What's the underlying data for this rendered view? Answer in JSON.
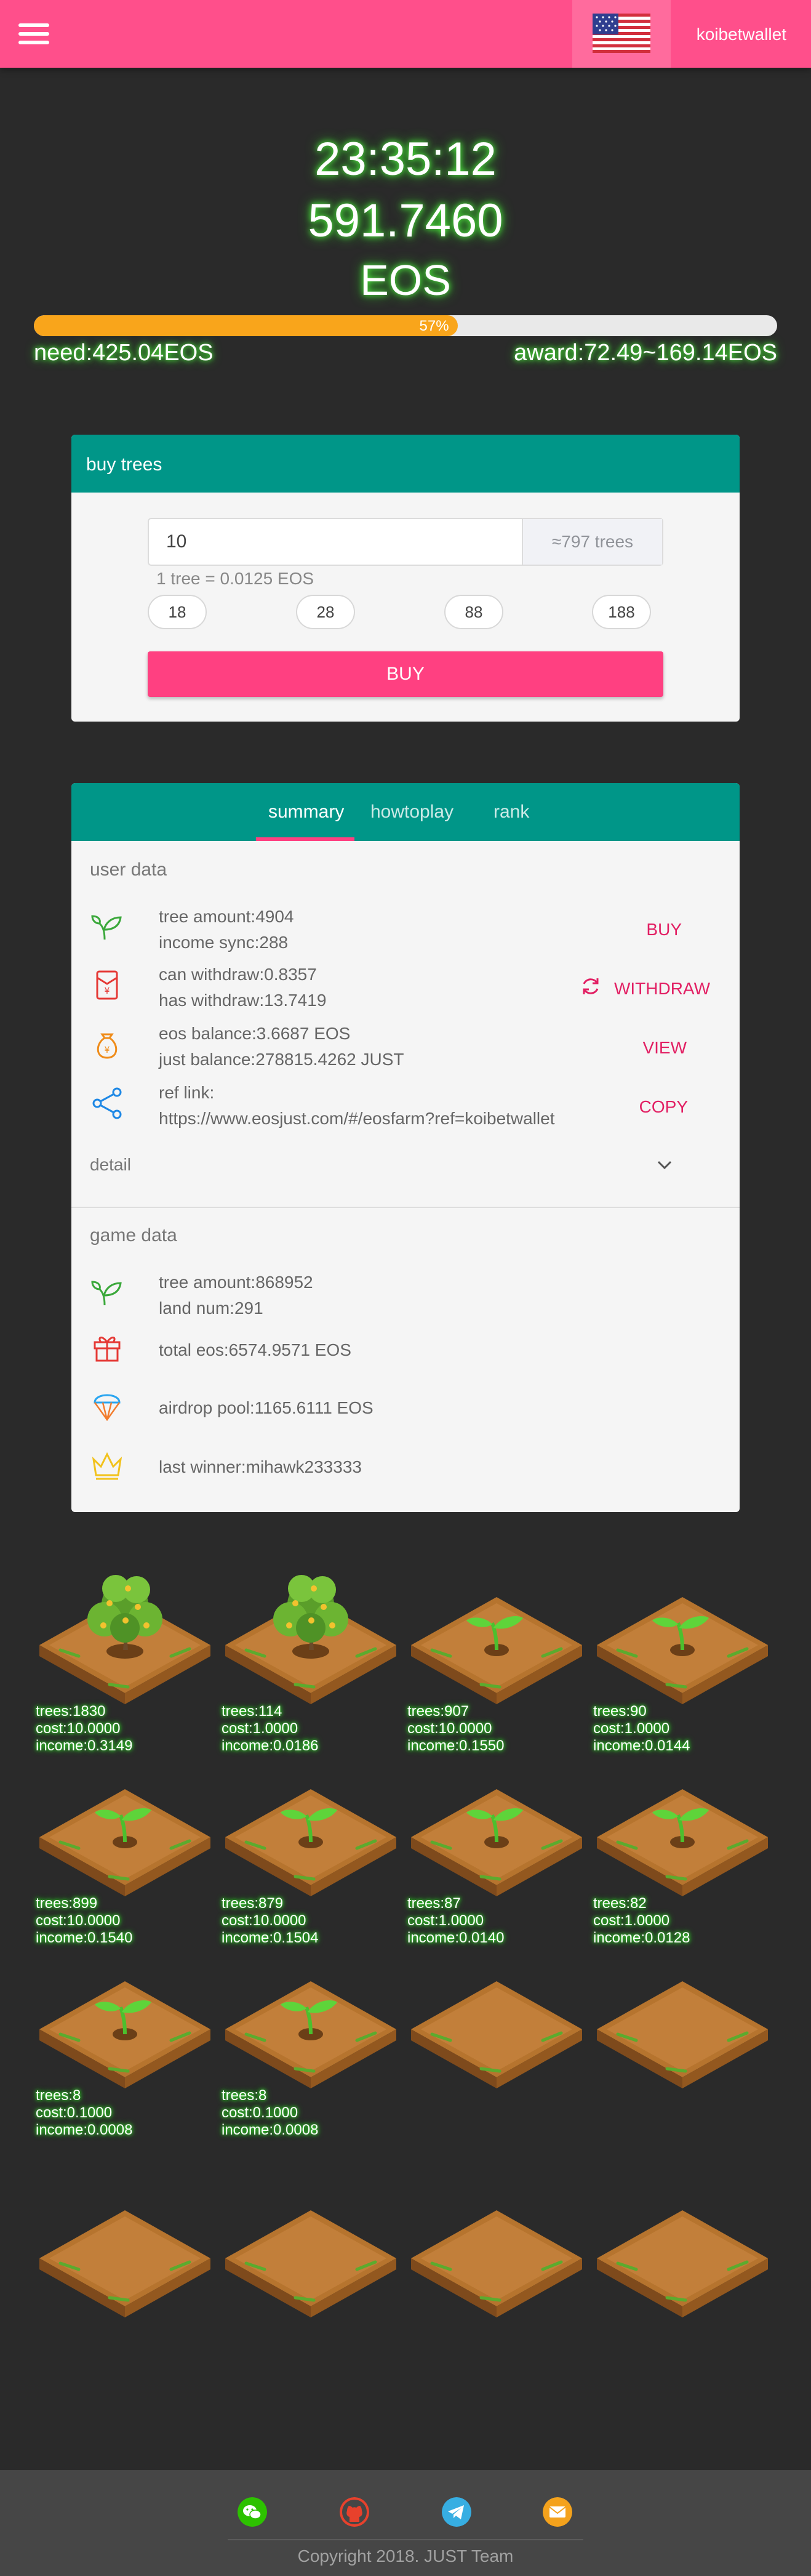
{
  "header": {
    "username": "koibetwallet",
    "flag_icon": "us-flag-icon"
  },
  "hero": {
    "time": "23:35:12",
    "pool": "591.7460",
    "unit": "EOS",
    "progress_label": "57%",
    "progress_fraction": 0.57,
    "need": "need:425.04EOS",
    "award": "award:72.49~169.14EOS"
  },
  "buy": {
    "title": "buy trees",
    "input_value": "10",
    "estimate": "≈797 trees",
    "rate": "1 tree = 0.0125 EOS",
    "chips": [
      "18",
      "28",
      "88",
      "188"
    ],
    "button": "BUY"
  },
  "tabs": [
    "summary",
    "howtoplay",
    "rank"
  ],
  "user_data": {
    "label": "user data",
    "rows": [
      {
        "line1": "tree amount:4904",
        "line2": "income sync:288",
        "action": "BUY"
      },
      {
        "line1": "can withdraw:0.8357",
        "line2": "has withdraw:13.7419",
        "action": "WITHDRAW"
      },
      {
        "line1": "eos balance:3.6687 EOS",
        "line2": "just balance:278815.4262 JUST",
        "action": "VIEW"
      },
      {
        "line1": "ref link:",
        "line2": "https://www.eosjust.com/#/eosfarm?ref=koibetwallet",
        "action": "COPY"
      }
    ],
    "detail": "detail"
  },
  "game_data": {
    "label": "game data",
    "rows": [
      {
        "line1": "tree amount:868952",
        "line2": "land num:291"
      },
      {
        "line1": "total eos:6574.9571 EOS"
      },
      {
        "line1": "airdrop pool:1165.6111 EOS"
      },
      {
        "line1": "last winner:mihawk233333"
      }
    ]
  },
  "plots": [
    {
      "kind": "tree",
      "trees": "trees:1830",
      "cost": "cost:10.0000",
      "income": "income:0.3149"
    },
    {
      "kind": "tree",
      "trees": "trees:114",
      "cost": "cost:1.0000",
      "income": "income:0.0186"
    },
    {
      "kind": "sprout",
      "trees": "trees:907",
      "cost": "cost:10.0000",
      "income": "income:0.1550"
    },
    {
      "kind": "sprout",
      "trees": "trees:90",
      "cost": "cost:1.0000",
      "income": "income:0.0144"
    },
    {
      "kind": "sprout",
      "trees": "trees:899",
      "cost": "cost:10.0000",
      "income": "income:0.1540"
    },
    {
      "kind": "sprout",
      "trees": "trees:879",
      "cost": "cost:10.0000",
      "income": "income:0.1504"
    },
    {
      "kind": "sprout",
      "trees": "trees:87",
      "cost": "cost:1.0000",
      "income": "income:0.0140"
    },
    {
      "kind": "sprout",
      "trees": "trees:82",
      "cost": "cost:1.0000",
      "income": "income:0.0128"
    },
    {
      "kind": "sprout",
      "trees": "trees:8",
      "cost": "cost:0.1000",
      "income": "income:0.0008"
    },
    {
      "kind": "sprout",
      "trees": "trees:8",
      "cost": "cost:0.1000",
      "income": "income:0.0008"
    },
    {
      "kind": "empty"
    },
    {
      "kind": "empty"
    },
    {
      "kind": "empty"
    },
    {
      "kind": "empty"
    },
    {
      "kind": "empty"
    },
    {
      "kind": "empty"
    }
  ],
  "footer": {
    "icons": [
      "wechat-icon",
      "github-icon",
      "telegram-icon",
      "email-icon"
    ],
    "copyright": "Copyright 2018. JUST Team"
  },
  "colors": {
    "brand": "#ff4f8b",
    "teal": "#009688",
    "accent": "#ff4081",
    "progress": "#f9a51b",
    "glow": "#56ff43"
  }
}
